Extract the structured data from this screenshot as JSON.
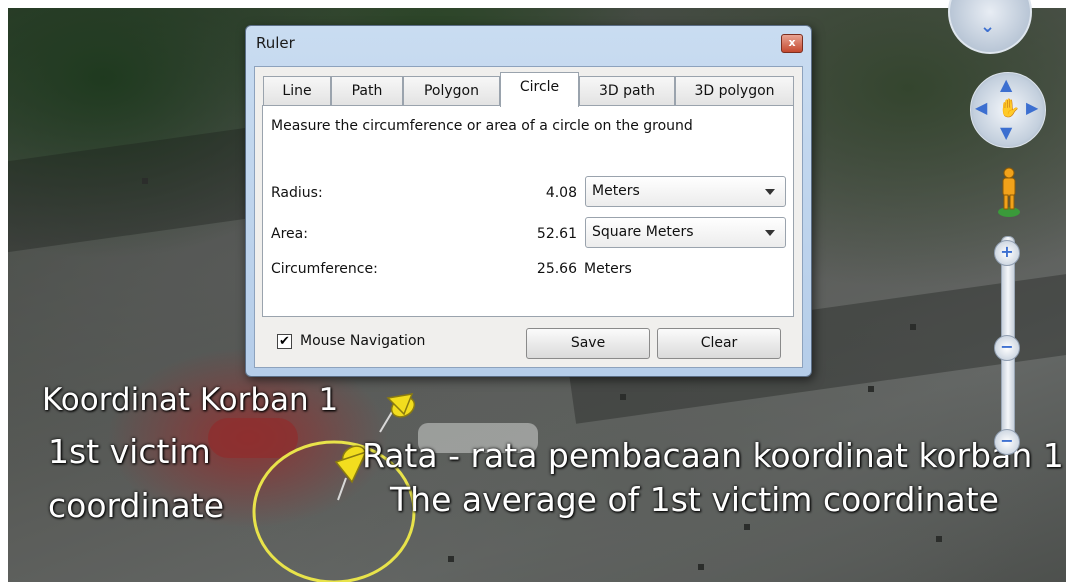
{
  "ruler": {
    "title": "Ruler",
    "close_glyph": "x",
    "tabs": [
      "Line",
      "Path",
      "Polygon",
      "Circle",
      "3D path",
      "3D polygon"
    ],
    "active_tab": "Circle",
    "description": "Measure the circumference or area of a circle on the ground",
    "radius": {
      "label": "Radius:",
      "value": "4.08",
      "unit": "Meters"
    },
    "area": {
      "label": "Area:",
      "value": "52.61",
      "unit": "Square Meters"
    },
    "circumference": {
      "label": "Circumference:",
      "value": "25.66",
      "unit": "Meters"
    },
    "mouse_navigation": {
      "label": "Mouse Navigation",
      "checked": true
    },
    "save_label": "Save",
    "clear_label": "Clear"
  },
  "captions": {
    "line1": "Koordinat Korban 1",
    "line2": "1st victim",
    "line3": "coordinate",
    "line4": "Rata - rata pembacaan koordinat korban 1",
    "line5": "The average of 1st victim coordinate"
  },
  "nav_controls": {
    "zoom_in_glyph": "+",
    "zoom_out_glyph": "−",
    "slider_glyph": "−"
  },
  "colors": {
    "measure_circle": "#e8e34a",
    "pin": "#f2dd1e"
  }
}
